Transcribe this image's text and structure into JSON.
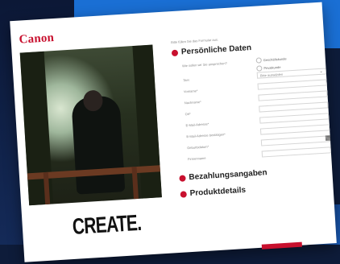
{
  "brand": {
    "logo_text": "Canon",
    "tagline": "CREATE."
  },
  "form": {
    "intro": "Bitte füllen Sie das Formular aus.",
    "sections": [
      {
        "title": "Persönliche Daten"
      },
      {
        "title": "Bezahlungsangaben"
      },
      {
        "title": "Produktdetails"
      }
    ],
    "question": "Wie sollen wir Sie ansprechen?",
    "radios": [
      "Geschäftskunde",
      "Privatkunde"
    ],
    "fields": [
      {
        "label": "Titel",
        "value": "Bitte auswählen"
      },
      {
        "label": "Vorname*",
        "value": ""
      },
      {
        "label": "Nachname*",
        "value": ""
      },
      {
        "label": "Ort*",
        "value": ""
      },
      {
        "label": "E-Mail-Adresse*",
        "value": ""
      },
      {
        "label": "E-Mail-Adresse bestätigen*",
        "value": ""
      },
      {
        "label": "Geburtsdatum*",
        "value": ""
      },
      {
        "label": "Firmenname",
        "value": ""
      }
    ]
  },
  "colors": {
    "accent": "#c8102e",
    "backdrop": "#0e1c3a",
    "blue": "#1a6fd4"
  }
}
